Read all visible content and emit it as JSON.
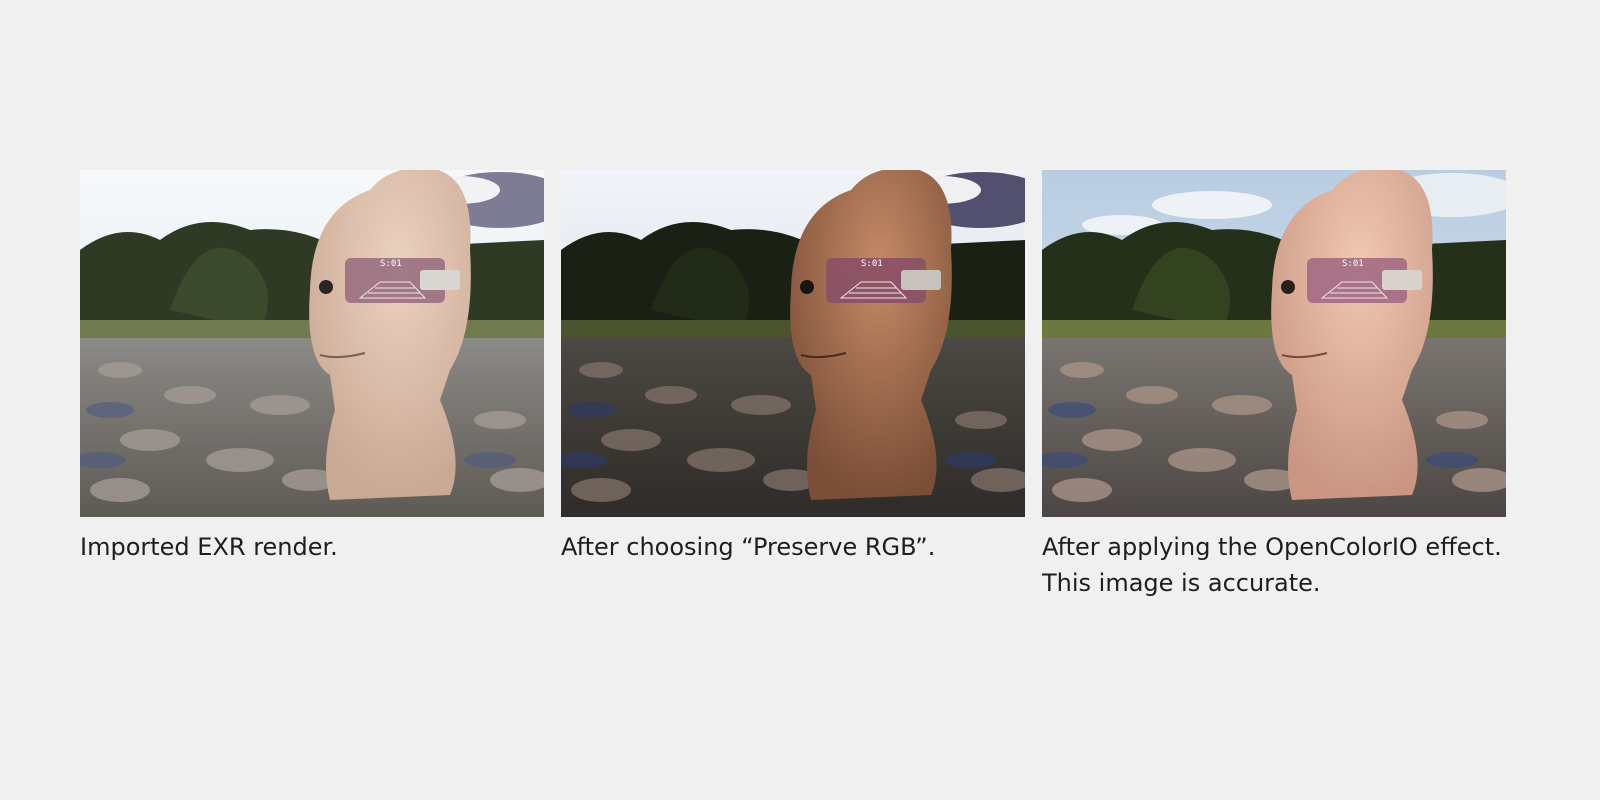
{
  "figure": {
    "panels": [
      {
        "id": "imported",
        "caption_lines": [
          "Imported EXR render."
        ],
        "tone": "neutral-pale",
        "hud_readout": "S:01"
      },
      {
        "id": "preserve-rgb",
        "caption_lines": [
          "After choosing “Preserve RGB”."
        ],
        "tone": "dark-saturated",
        "hud_readout": "S:01"
      },
      {
        "id": "opencolorio",
        "caption_lines": [
          "After applying the OpenColorIO effect.",
          "This image is accurate."
        ],
        "tone": "accurate",
        "hud_readout": "S:01"
      }
    ]
  },
  "colors": {
    "background": "#f0f0f0",
    "caption_text": "#1e1e1e"
  }
}
